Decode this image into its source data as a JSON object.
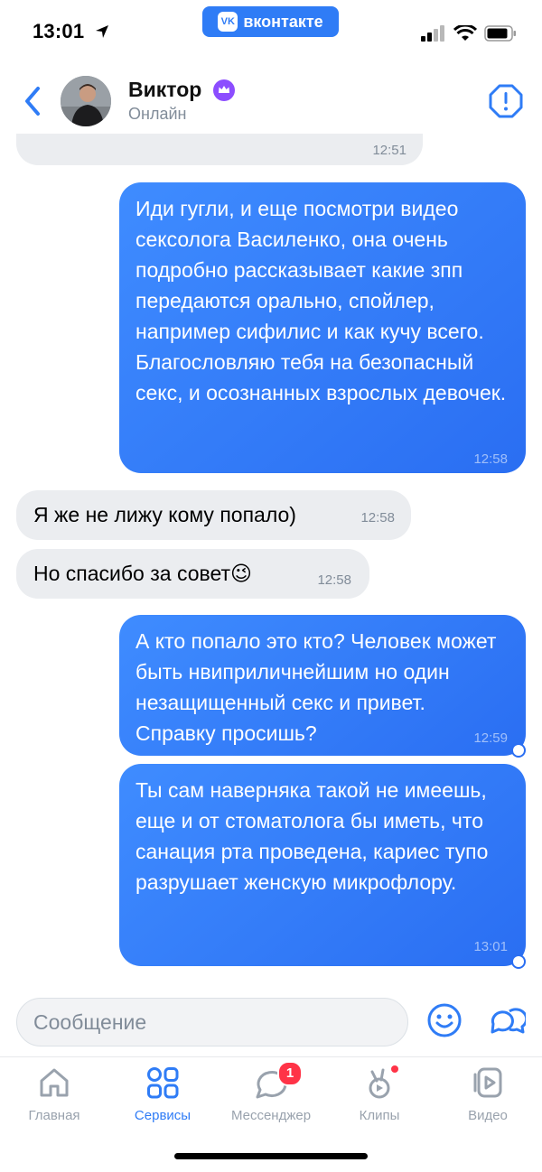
{
  "status_bar": {
    "time": "13:01",
    "app_badge": "вконтакте",
    "app_badge_logo": "VK"
  },
  "header": {
    "name": "Виктор",
    "status": "Онлайн"
  },
  "messages": [
    {
      "direction": "in",
      "text": "",
      "time": "12:51"
    },
    {
      "direction": "out",
      "text": "Иди гугли, и еще посмотри видео сексолога Василенко, она очень подробно рассказывает какие зпп передаются орально, спойлер, например сифилис и как кучу всего. Благословляю тебя на безопасный секс, и осознанных взрослых девочек.",
      "time": "12:58"
    },
    {
      "direction": "in",
      "text": "Я же не лижу кому попало)",
      "time": "12:58"
    },
    {
      "direction": "in",
      "text": "Но спасибо за совет😉",
      "time": "12:58"
    },
    {
      "direction": "out",
      "text": "А кто попало это кто? Человек может быть нвиприличнейшим но один незащищенный секс и привет. Справку просишь?",
      "time": "12:59"
    },
    {
      "direction": "out",
      "text": "Ты сам наверняка такой не имеешь, еще и от стоматолога бы иметь, что санация рта проведена, кариес тупо разрушает женскую микрофлору.",
      "time": "13:01"
    }
  ],
  "composer": {
    "placeholder": "Сообщение"
  },
  "tabs": [
    {
      "label": "Главная",
      "icon": "home-icon"
    },
    {
      "label": "Сервисы",
      "icon": "services-grid-icon",
      "active": true
    },
    {
      "label": "Мессенджер",
      "icon": "messenger-icon",
      "badge": "1"
    },
    {
      "label": "Клипы",
      "icon": "clips-icon"
    },
    {
      "label": "Видео",
      "icon": "video-icon"
    }
  ],
  "colors": {
    "accent": "#2f7cf6",
    "outgoing_bubble": "#2a6ef2",
    "incoming_bubble": "#ebedf0",
    "badge": "#ff3347"
  }
}
